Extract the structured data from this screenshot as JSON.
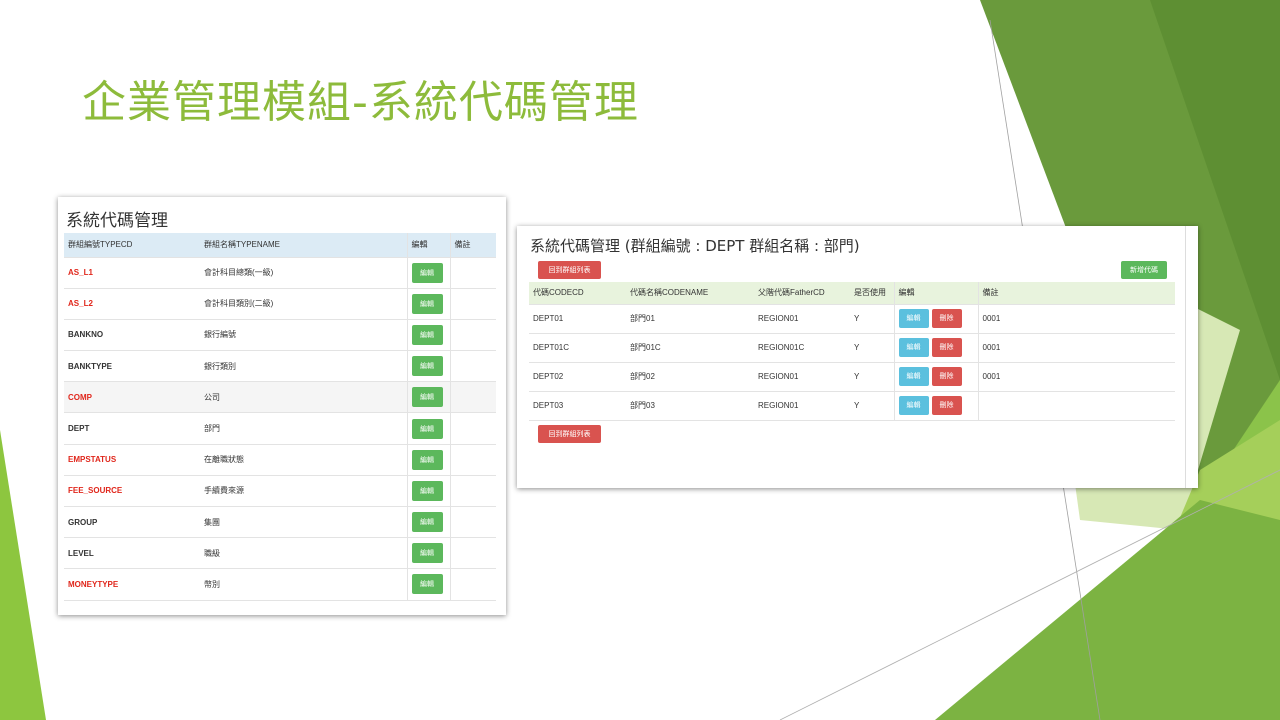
{
  "slide": {
    "title": "企業管理模組-系統代碼管理"
  },
  "left_panel": {
    "title": "系統代碼管理",
    "columns": [
      "群組編號TYPECD",
      "群組名稱TYPENAME",
      "編輯",
      "備註"
    ],
    "edit_label": "編輯",
    "rows": [
      {
        "code": "AS_L1",
        "name": "會計科目總類(一級)",
        "style": "red"
      },
      {
        "code": "AS_L2",
        "name": "會計科目類別(二級)",
        "style": "red"
      },
      {
        "code": "BANKNO",
        "name": "銀行編號",
        "style": "dark"
      },
      {
        "code": "BANKTYPE",
        "name": "銀行類別",
        "style": "dark"
      },
      {
        "code": "COMP",
        "name": "公司",
        "style": "red"
      },
      {
        "code": "DEPT",
        "name": "部門",
        "style": "dark"
      },
      {
        "code": "EMPSTATUS",
        "name": "在離職狀態",
        "style": "red"
      },
      {
        "code": "FEE_SOURCE",
        "name": "手續費來源",
        "style": "red"
      },
      {
        "code": "GROUP",
        "name": "集團",
        "style": "dark"
      },
      {
        "code": "LEVEL",
        "name": "職級",
        "style": "dark"
      },
      {
        "code": "MONEYTYPE",
        "name": "幣別",
        "style": "red"
      }
    ]
  },
  "right_panel": {
    "title": "系統代碼管理 (群組編號 : DEPT 群組名稱 : 部門)",
    "back_button": "回到群組列表",
    "add_button": "新增代碼",
    "columns": [
      "代碼CODECD",
      "代碼名稱CODENAME",
      "父階代碼FatherCD",
      "是否使用",
      "編輯",
      "備註"
    ],
    "edit_label": "編輯",
    "delete_label": "刪除",
    "rows": [
      {
        "code": "DEPT01",
        "name": "部門01",
        "father": "REGION01",
        "used": "Y",
        "note": "0001"
      },
      {
        "code": "DEPT01C",
        "name": "部門01C",
        "father": "REGION01C",
        "used": "Y",
        "note": "0001"
      },
      {
        "code": "DEPT02",
        "name": "部門02",
        "father": "REGION01",
        "used": "Y",
        "note": "0001"
      },
      {
        "code": "DEPT03",
        "name": "部門03",
        "father": "REGION01",
        "used": "Y",
        "note": ""
      }
    ]
  },
  "colors": {
    "title_green": "#8dbb3b",
    "code_red": "#e0261b",
    "button_green": "#5cb85c",
    "button_blue": "#5bc0de",
    "button_red": "#d9534f",
    "left_header_bg": "#dcebf5",
    "right_header_bg": "#e8f3dd"
  }
}
